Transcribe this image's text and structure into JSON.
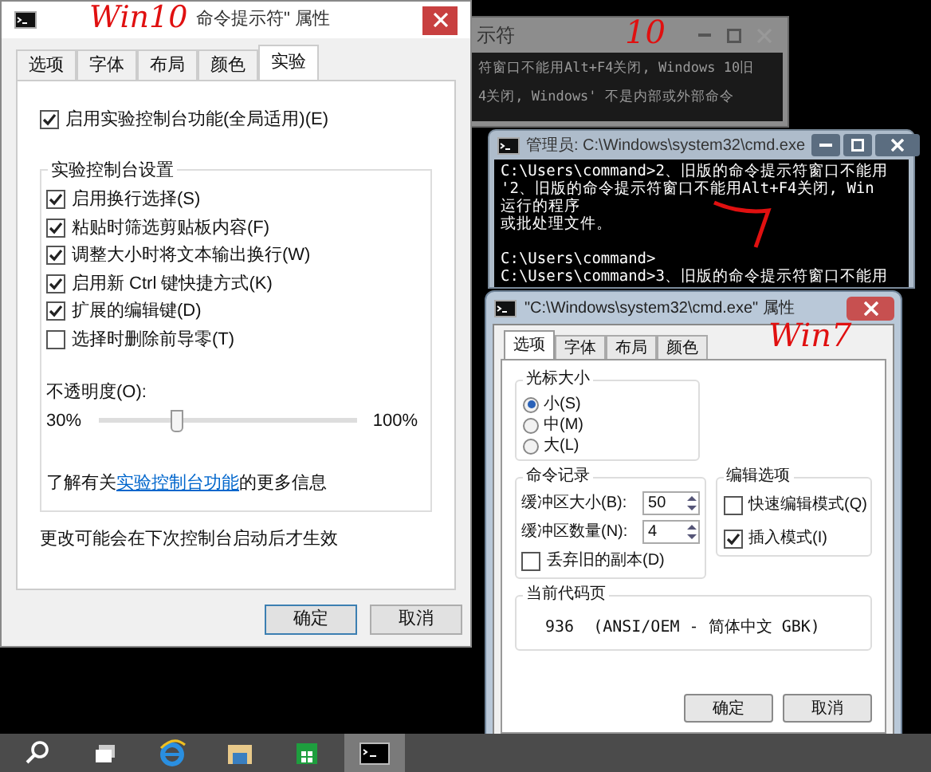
{
  "background_console": {
    "title": "示符",
    "lines": [
      "符窗口不能用Alt+F4关闭, Windows 10旧",
      "4关闭, Windows' 不是内部或外部命令"
    ]
  },
  "admin_console": {
    "title": "管理员: C:\\Windows\\system32\\cmd.exe",
    "blocks": [
      [
        "C:\\Users\\command>2、旧版的命令提示符窗口不能用",
        "'2、旧版的命令提示符窗口不能用Alt+F4关闭, Win",
        "运行的程序",
        "或批处理文件。"
      ],
      [
        "C:\\Users\\command>",
        "C:\\Users\\command>3、旧版的命令提示符窗口不能用"
      ]
    ]
  },
  "win10_dialog": {
    "title": "命令提示符\" 属性",
    "tabs": [
      {
        "label": "选项",
        "selected": false
      },
      {
        "label": "字体",
        "selected": false
      },
      {
        "label": "布局",
        "selected": false
      },
      {
        "label": "颜色",
        "selected": false
      },
      {
        "label": "实验",
        "selected": true
      }
    ],
    "enable_experimental": {
      "label": "启用实验控制台功能(全局适用)(E)",
      "checked": true
    },
    "group_title": "实验控制台设置",
    "options": [
      {
        "label": "启用换行选择(S)",
        "checked": true
      },
      {
        "label": "粘贴时筛选剪贴板内容(F)",
        "checked": true
      },
      {
        "label": "调整大小时将文本输出换行(W)",
        "checked": true
      },
      {
        "label": "启用新 Ctrl 键快捷方式(K)",
        "checked": true
      },
      {
        "label": "扩展的编辑键(D)",
        "checked": true
      },
      {
        "label": "选择时删除前导零(T)",
        "checked": false
      }
    ],
    "opacity": {
      "label": "不透明度(O):",
      "min_label": "30%",
      "max_label": "100%",
      "level": 0.3
    },
    "link_prefix": "了解有关",
    "link": "实验控制台功能",
    "link_suffix": "的更多信息",
    "note": "更改可能会在下次控制台启动后才生效",
    "buttons": [
      "确定",
      "取消"
    ]
  },
  "win7_dialog": {
    "title": "\"C:\\Windows\\system32\\cmd.exe\" 属性",
    "tabs": [
      {
        "label": "选项",
        "selected": true
      },
      {
        "label": "字体",
        "selected": false
      },
      {
        "label": "布局",
        "selected": false
      },
      {
        "label": "颜色",
        "selected": false
      }
    ],
    "cursor_size": {
      "title": "光标大小",
      "options": [
        {
          "label": "小(S)",
          "selected": true
        },
        {
          "label": "中(M)",
          "selected": false
        },
        {
          "label": "大(L)",
          "selected": false
        }
      ]
    },
    "history": {
      "title": "命令记录",
      "fields": [
        {
          "label": "缓冲区大小(B):",
          "value": "50"
        },
        {
          "label": "缓冲区数量(N):",
          "value": "4"
        }
      ],
      "discard": {
        "label": "丢弃旧的副本(D)",
        "checked": false
      }
    },
    "edit_options": {
      "title": "编辑选项",
      "options": [
        {
          "label": "快速编辑模式(Q)",
          "checked": false
        },
        {
          "label": "插入模式(I)",
          "checked": true
        }
      ]
    },
    "code_page": {
      "title": "当前代码页",
      "value": "936",
      "name": "(ANSI/OEM - 简体中文 GBK)"
    },
    "buttons": [
      "确定",
      "取消"
    ]
  },
  "annotations": [
    "Win10",
    "10",
    "Win7"
  ],
  "taskbar": {
    "items": [
      {
        "kind": "search",
        "selected": false
      },
      {
        "kind": "taskview",
        "selected": false
      },
      {
        "kind": "browser",
        "selected": false
      },
      {
        "kind": "folder",
        "selected": false
      },
      {
        "kind": "store",
        "selected": false
      },
      {
        "kind": "console",
        "selected": true
      }
    ]
  }
}
